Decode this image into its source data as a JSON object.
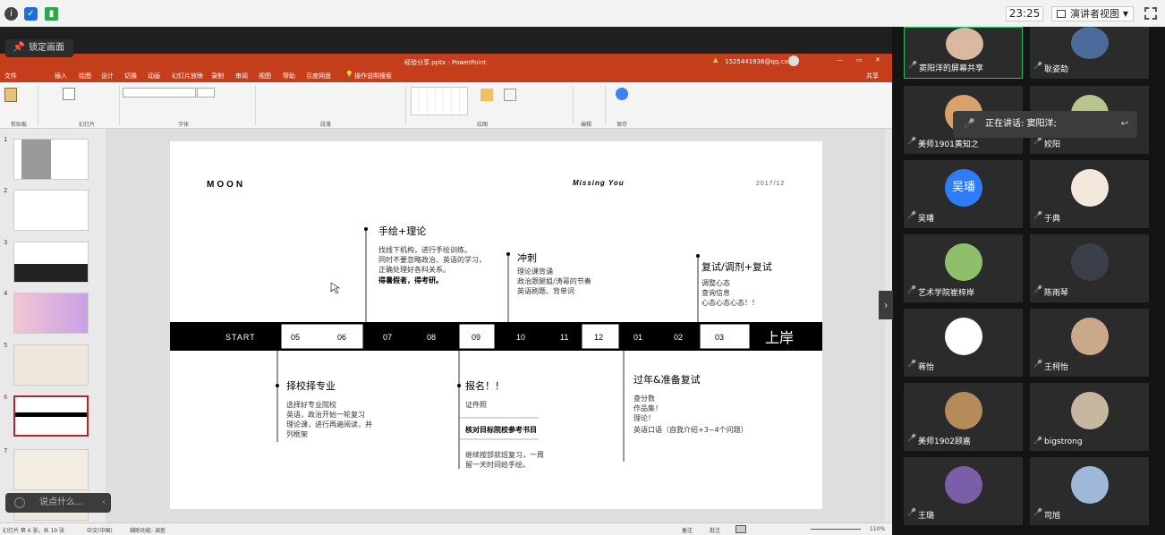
{
  "topbar": {
    "time": "23:25",
    "presenter_view": "演讲者视图"
  },
  "lock_label": "锁定画面",
  "ppt": {
    "title": "经验分享.pptx - PowerPoint",
    "account": "1525441936@qq.com",
    "share": "共享",
    "menu": [
      "文件",
      "开始",
      "插入",
      "绘图",
      "设计",
      "切换",
      "动画",
      "幻灯片放映",
      "录制",
      "审阅",
      "视图",
      "帮助",
      "百度网盘",
      "操作说明搜索"
    ],
    "ribbon_groups": [
      "剪贴板",
      "幻灯片",
      "字体",
      "段落",
      "绘图",
      "编辑",
      "保存"
    ],
    "status": {
      "slide": "幻灯片 第 6 张，共 19 张",
      "lang": "中文(中国)",
      "access": "辅助功能: 调查",
      "notes": "备注",
      "comments": "批注",
      "zoom": "110%"
    }
  },
  "slide": {
    "brand": "MOON",
    "tag": "Missing You",
    "date": "2017/12",
    "start": "START",
    "end": "上岸",
    "months": [
      "05",
      "06",
      "07",
      "08",
      "09",
      "10",
      "11",
      "12",
      "01",
      "02",
      "03"
    ],
    "top": [
      {
        "title": "手绘+理论",
        "lines": [
          "找线下机构，进行手绘训练。",
          "同时不要忽略政治、英语的学习，",
          "正确处理好各科关系。",
          "得暑假者，得考研。"
        ]
      },
      {
        "title": "冲刺",
        "lines": [
          "理论课背诵",
          "政治跟腿姐/涛哥的节奏",
          "英语刷题、背单词"
        ]
      },
      {
        "title": "复试/调剂+复试",
        "lines": [
          "调整心态",
          "查询信息",
          "心态心态心态！！"
        ]
      }
    ],
    "bottom": [
      {
        "title": "择校择专业",
        "lines": [
          "选择好专业院校",
          "英语，政治开始一轮复习",
          "理论课，进行再遍阅读，并",
          "列框架"
        ]
      },
      {
        "title": "报名！！",
        "lines": [
          "证件照",
          "核对目标院校参考书目",
          "继续按部就班复习，一周",
          "留一天时间给手绘。"
        ]
      },
      {
        "title": "过年&准备复试",
        "lines": [
          "查分数",
          "作品集！",
          "理论！",
          "英语口语（自我介绍+3~4个问题）"
        ]
      }
    ]
  },
  "chat_placeholder": "说点什么...",
  "speaking": "正在讲话: 窦阳洋;",
  "participants": [
    "窦阳洋的屏幕共享",
    "耿姿劼",
    "美师1901黄知之",
    "姣阳",
    "吴璠",
    "于典",
    "艺术学院崔梓岸",
    "陈雨琴",
    "蒋怡",
    "王柯怡",
    "美师1902顾嘉",
    "bigstrong",
    "王璐",
    "司旭"
  ],
  "avatar_texts": {
    "wufan": "吴璠"
  },
  "colors": {
    "ppt_red": "#c43e1c",
    "accent_blue": "#2d7df6"
  }
}
